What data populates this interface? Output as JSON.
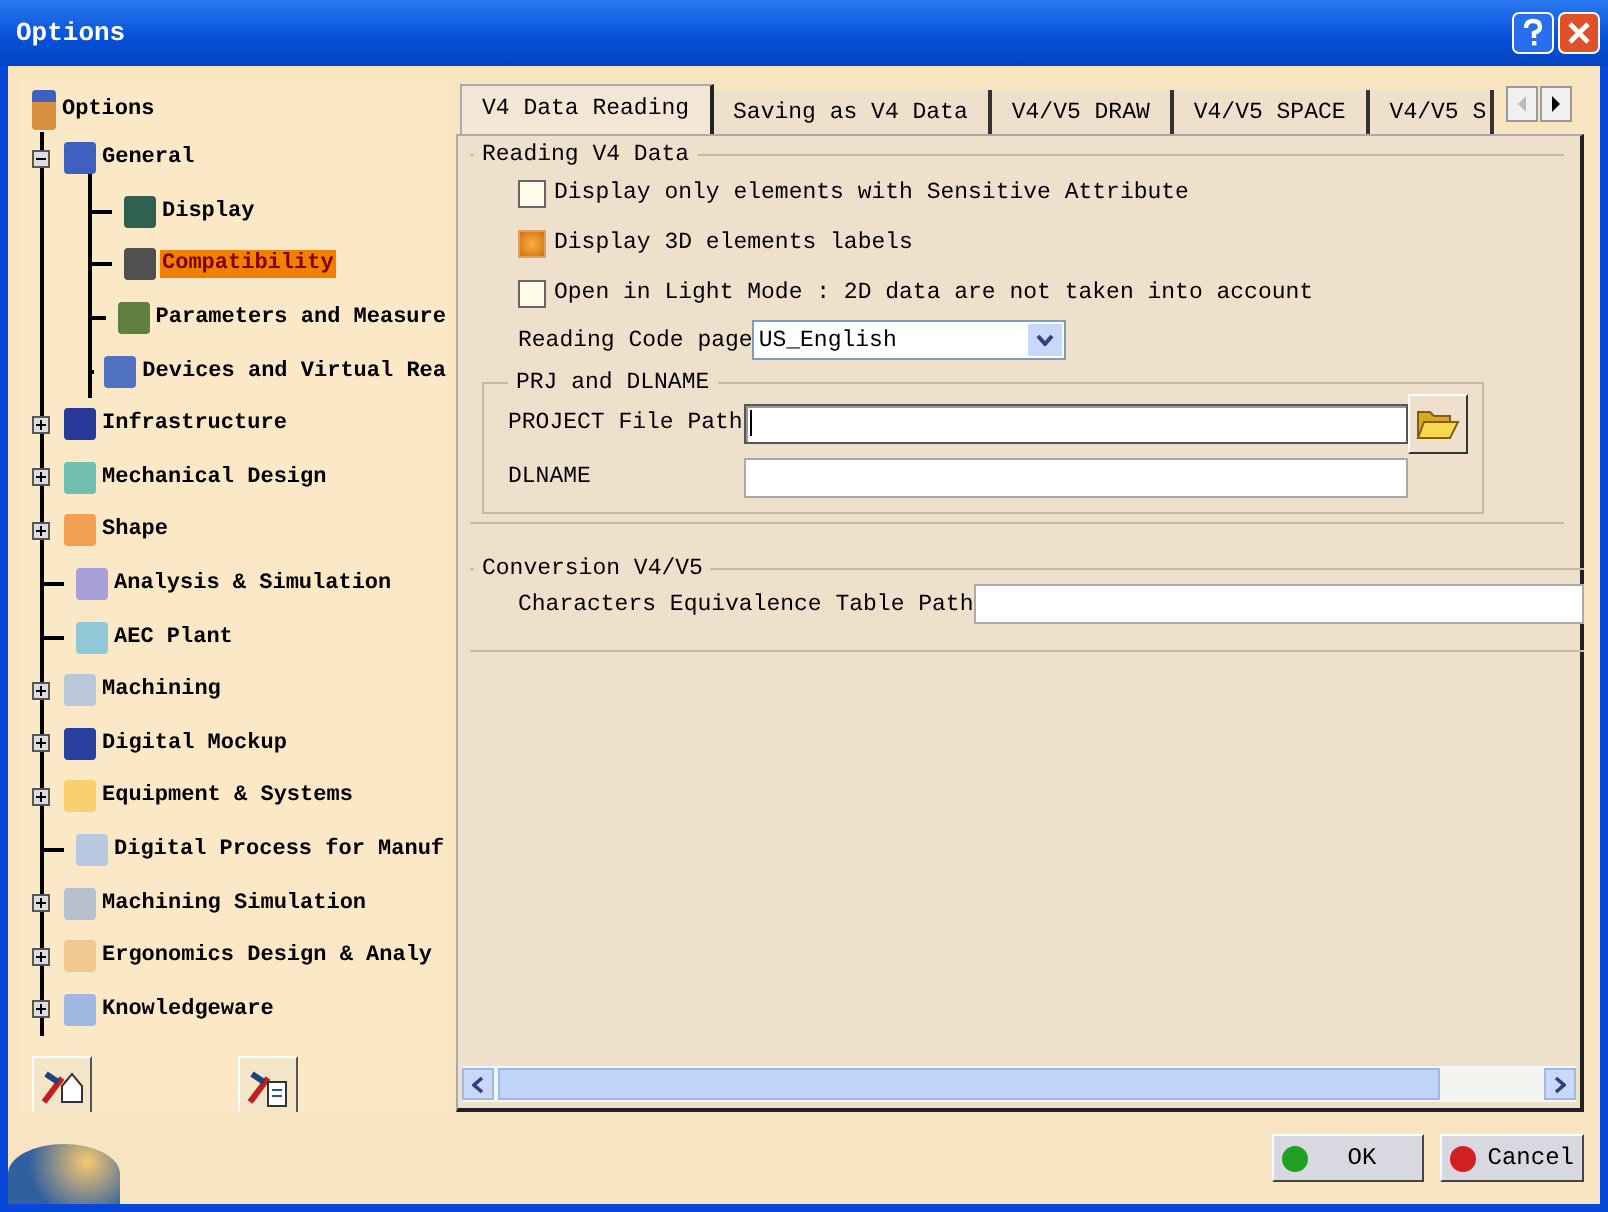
{
  "window": {
    "title": "Options"
  },
  "tree": {
    "label": "Options",
    "children": [
      {
        "label": "General",
        "expanded": true,
        "color": "#4060c0",
        "selected": false,
        "children": [
          {
            "label": "Display",
            "color": "#306050",
            "selected": false
          },
          {
            "label": "Compatibility",
            "color": "#505050",
            "selected": true
          },
          {
            "label": "Parameters and Measure",
            "color": "#608040",
            "selected": false
          },
          {
            "label": "Devices and Virtual Rea",
            "color": "#5070c0",
            "selected": false
          }
        ]
      },
      {
        "label": "Infrastructure",
        "expanded": false,
        "color": "#2a3a9a",
        "selected": false
      },
      {
        "label": "Mechanical Design",
        "expanded": false,
        "color": "#70c0b0",
        "selected": false
      },
      {
        "label": "Shape",
        "expanded": false,
        "color": "#f0a050",
        "selected": false
      },
      {
        "label": "Analysis & Simulation",
        "color": "#a8a0d8",
        "selected": false
      },
      {
        "label": "AEC Plant",
        "color": "#90c8d8",
        "selected": false
      },
      {
        "label": "Machining",
        "expanded": false,
        "color": "#b8c8d8",
        "selected": false
      },
      {
        "label": "Digital Mockup",
        "expanded": false,
        "color": "#2a40a0",
        "selected": false
      },
      {
        "label": "Equipment & Systems",
        "expanded": false,
        "color": "#f8d070",
        "selected": false
      },
      {
        "label": "Digital Process for Manuf",
        "color": "#b8c8e0",
        "selected": false
      },
      {
        "label": "Machining Simulation",
        "expanded": false,
        "color": "#b8c0d0",
        "selected": false
      },
      {
        "label": "Ergonomics Design & Analy",
        "expanded": false,
        "color": "#f0c890",
        "selected": false
      },
      {
        "label": "Knowledgeware",
        "expanded": false,
        "color": "#a0b8e0",
        "selected": false
      }
    ]
  },
  "tabs": [
    {
      "label": "V4 Data Reading",
      "selected": true
    },
    {
      "label": "Saving as V4 Data",
      "selected": false
    },
    {
      "label": "V4/V5 DRAW",
      "selected": false
    },
    {
      "label": "V4/V5 SPACE",
      "selected": false
    },
    {
      "label": "V4/V5 S",
      "selected": false
    }
  ],
  "tab_scroll": {
    "back_enabled": false,
    "forward_enabled": true
  },
  "reading_group": {
    "title": "Reading V4 Data",
    "options": [
      {
        "label": "Display only elements with Sensitive Attribute",
        "checked": false
      },
      {
        "label": "Display 3D elements labels",
        "checked": true
      },
      {
        "label": "Open in Light Mode : 2D data are not taken into account",
        "checked": false
      }
    ],
    "code_page": {
      "label": "Reading Code page",
      "value": "US_English"
    },
    "subgroup": {
      "title": "PRJ and DLNAME",
      "fields": [
        {
          "label": "PROJECT File Path",
          "browse": true,
          "focused": true
        },
        {
          "label": "DLNAME",
          "focused": false
        }
      ]
    }
  },
  "conversion_group": {
    "title": "Conversion V4/V5",
    "fields": [
      {
        "label": "Characters Equivalence Table Path"
      }
    ]
  },
  "buttons": [
    {
      "label": "OK",
      "kind": "ok"
    },
    {
      "label": "Cancel",
      "kind": "cancel"
    }
  ]
}
